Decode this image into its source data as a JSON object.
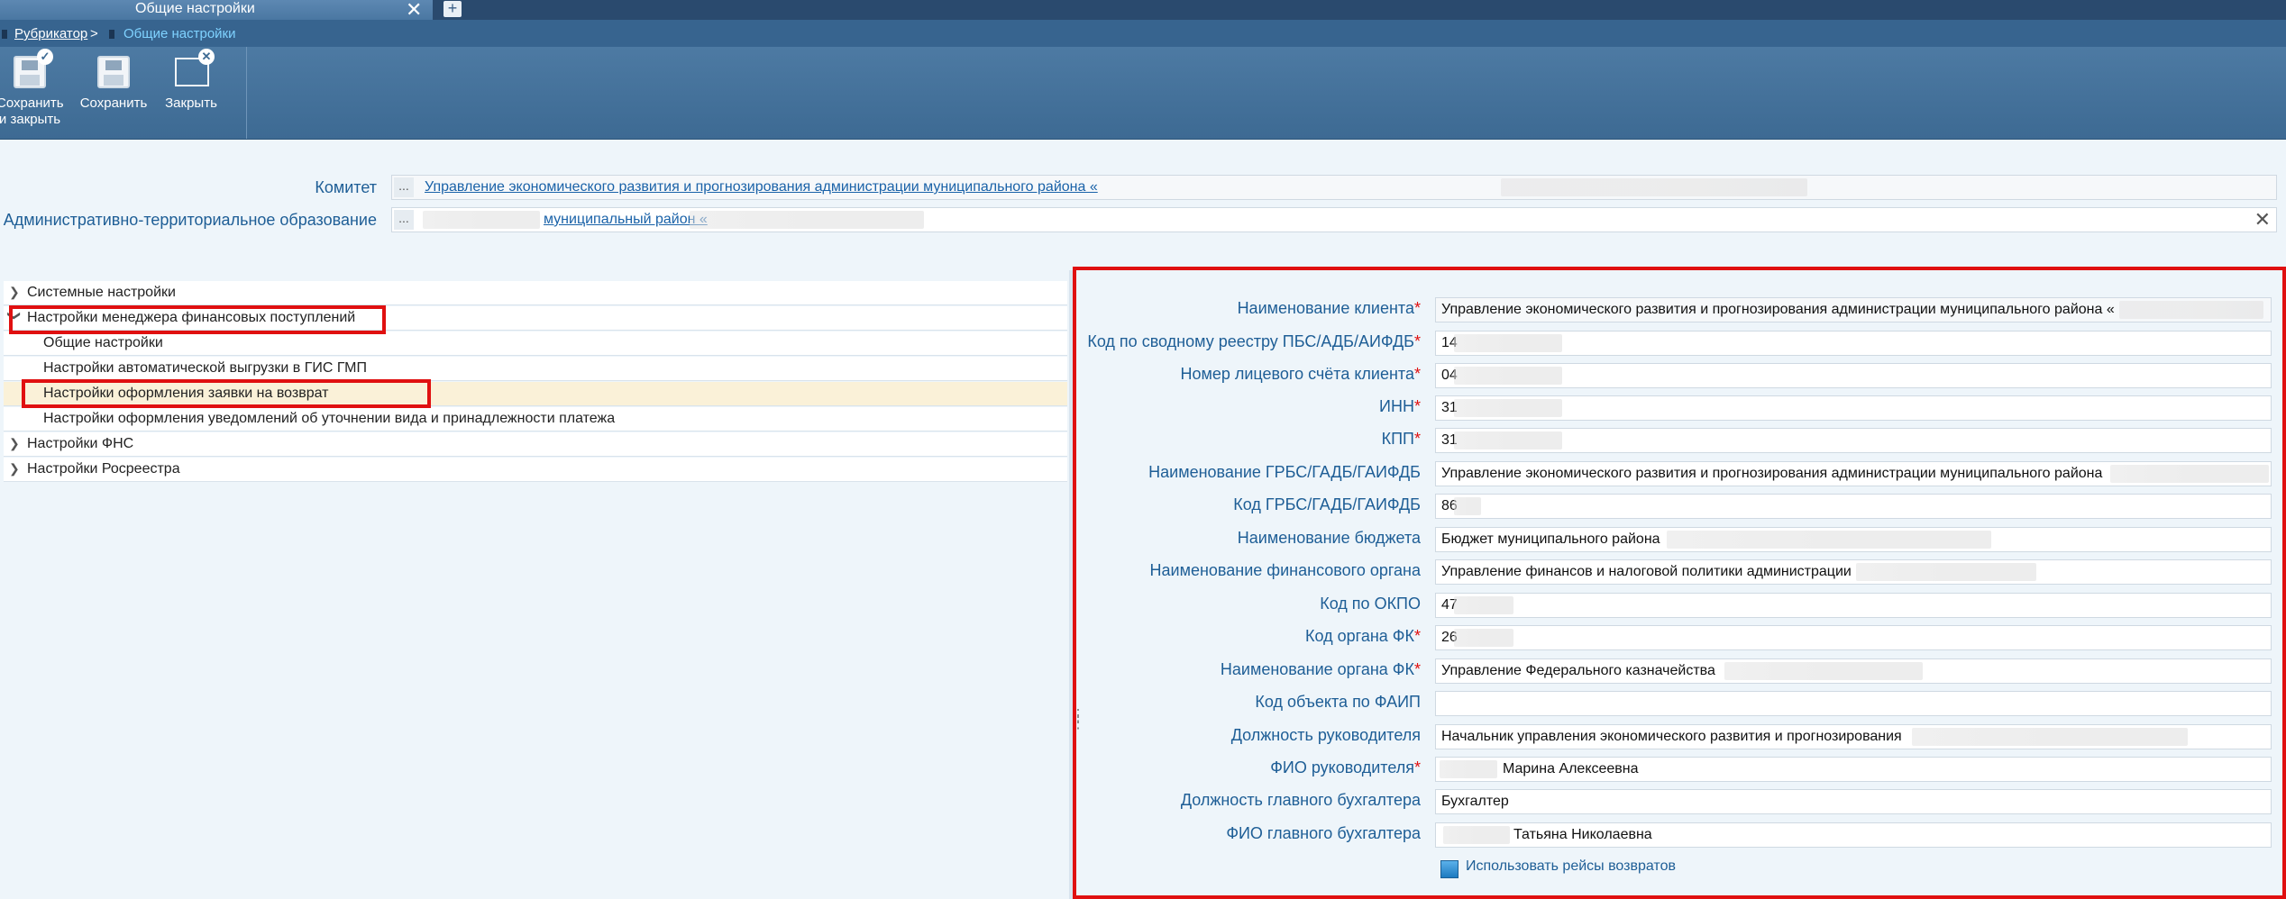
{
  "window": {
    "tab_title": "Общие настройки",
    "close_glyph": "✕",
    "add_glyph": "+"
  },
  "breadcrumb": {
    "root": "Рубрикатор",
    "separator": ">",
    "current": "Общие настройки"
  },
  "toolbar": {
    "save_close_label": "Сохранить и закрыть",
    "save_label": "Сохранить",
    "close_label": "Закрыть"
  },
  "header_fields": {
    "committee_label": "Комитет",
    "committee_value": "Управление экономического развития и прогнозирования администрации муниципального района «",
    "ato_label": "Административно-территориальное образование",
    "ato_value": "муниципальный район «",
    "dots": "..."
  },
  "tree": {
    "items": [
      {
        "label": "Системные настройки"
      },
      {
        "label": "Настройки менеджера финансовых поступлений"
      },
      {
        "label": "Общие настройки"
      },
      {
        "label": "Настройки автоматической выгрузки в ГИС ГМП"
      },
      {
        "label": "Настройки оформления заявки на возврат"
      },
      {
        "label": "Настройки оформления уведомлений об уточнении вида и принадлежности платежа"
      },
      {
        "label": "Настройки ФНС"
      },
      {
        "label": "Настройки Росреестра"
      }
    ]
  },
  "form": {
    "rows": [
      {
        "label": "Наименование клиента",
        "required": "*",
        "value": "Управление экономического развития и прогнозирования администрации муниципального района «"
      },
      {
        "label": "Код по сводному реестру ПБС/АДБ/АИФДБ",
        "required": "*",
        "value": "14"
      },
      {
        "label": "Номер лицевого счёта клиента",
        "required": "*",
        "value": "04"
      },
      {
        "label": "ИНН",
        "required": "*",
        "value": "31"
      },
      {
        "label": "КПП",
        "required": "*",
        "value": "31"
      },
      {
        "label": "Наименование ГРБС/ГАДБ/ГАИФДБ",
        "required": "",
        "value": "Управление экономического развития и прогнозирования администрации муниципального района"
      },
      {
        "label": "Код ГРБС/ГАДБ/ГАИФДБ",
        "required": "",
        "value": "86"
      },
      {
        "label": "Наименование бюджета",
        "required": "",
        "value": "Бюджет муниципального района"
      },
      {
        "label": "Наименование финансового органа",
        "required": "",
        "value": "Управление финансов и налоговой политики администрации"
      },
      {
        "label": "Код по ОКПО",
        "required": "",
        "value": "47"
      },
      {
        "label": "Код органа ФК",
        "required": "*",
        "value": "26"
      },
      {
        "label": "Наименование органа ФК",
        "required": "*",
        "value": "Управление Федерального казначейства"
      },
      {
        "label": "Код объекта по ФАИП",
        "required": "",
        "value": ""
      },
      {
        "label": "Должность руководителя",
        "required": "",
        "value": "Начальник управления экономического развития и прогнозирования"
      },
      {
        "label": "ФИО руководителя",
        "required": "*",
        "value": "Марина Алексеевна"
      },
      {
        "label": "Должность главного бухгалтера",
        "required": "",
        "value": "Бухгалтер"
      },
      {
        "label": "ФИО главного бухгалтера",
        "required": "",
        "value": "Татьяна Николаевна"
      }
    ],
    "checkbox_label": "Использовать рейсы возвратов"
  }
}
